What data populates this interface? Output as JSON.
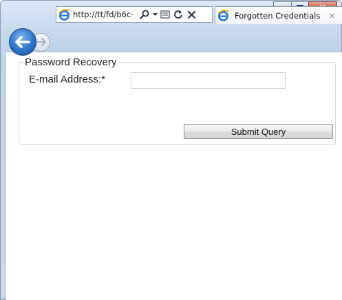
{
  "browser": {
    "address_url": "http://tt/fd/b6c·",
    "tab_title": "Forgotten Credentials",
    "tab_close": "×",
    "close_glyph": "✕"
  },
  "form": {
    "legend": "Password Recovery",
    "email_label": "E-mail Address:*",
    "email_value": "",
    "submit_label": "Submit Query"
  },
  "icons": {
    "back": "back-arrow-icon",
    "forward": "forward-arrow-icon",
    "browser": "ie-logo-icon",
    "search": "search-icon",
    "compat": "compatibility-view-icon",
    "refresh": "refresh-icon",
    "stop": "stop-icon"
  },
  "colors": {
    "back_button": "#2f73c9",
    "close_button": "#c03a2a"
  }
}
